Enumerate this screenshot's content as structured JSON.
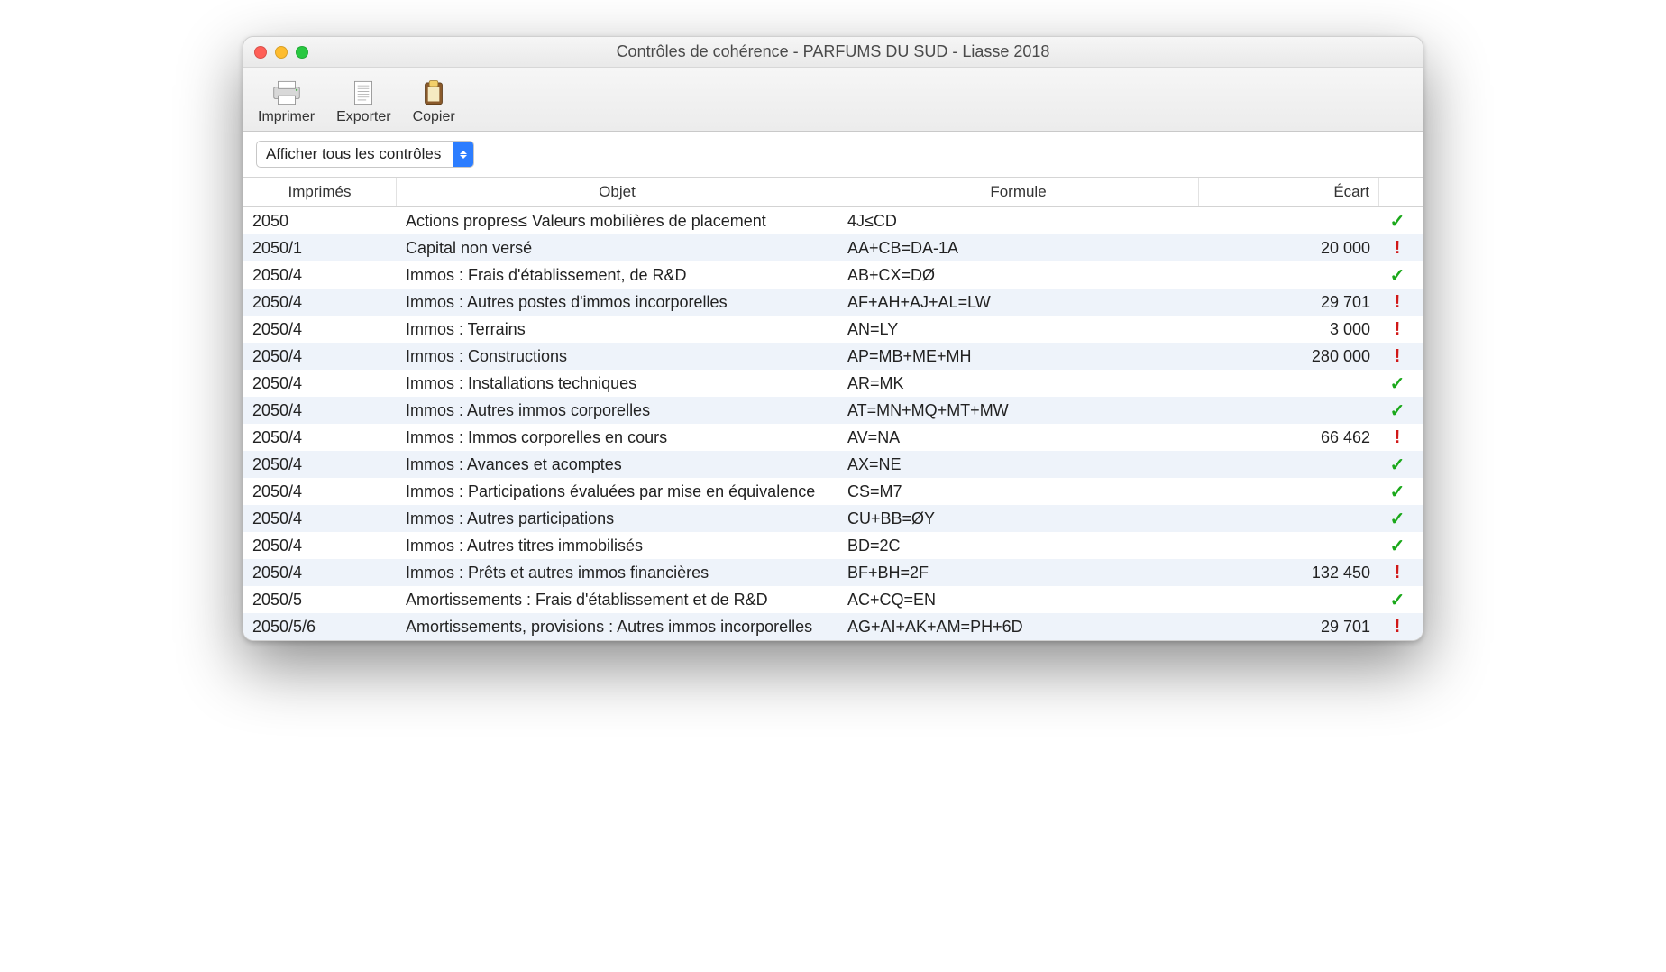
{
  "window": {
    "title": "Contrôles de cohérence - PARFUMS DU SUD - Liasse 2018"
  },
  "toolbar": {
    "print_label": "Imprimer",
    "export_label": "Exporter",
    "copy_label": "Copier"
  },
  "filter": {
    "selected": "Afficher tous les contrôles"
  },
  "columns": {
    "imprimes": "Imprimés",
    "objet": "Objet",
    "formule": "Formule",
    "ecart": "Écart"
  },
  "rows": [
    {
      "imprime": "2050",
      "objet": "Actions propres≤ Valeurs mobilières de placement",
      "formule": "4J≤CD",
      "ecart": "",
      "status": "ok"
    },
    {
      "imprime": "2050/1",
      "objet": "Capital non versé",
      "formule": "AA+CB=DA-1A",
      "ecart": "20 000",
      "status": "warn"
    },
    {
      "imprime": "2050/4",
      "objet": "Immos : Frais d'établissement, de R&D",
      "formule": "AB+CX=DØ",
      "ecart": "",
      "status": "ok"
    },
    {
      "imprime": "2050/4",
      "objet": "Immos : Autres postes d'immos incorporelles",
      "formule": "AF+AH+AJ+AL=LW",
      "ecart": "29 701",
      "status": "warn"
    },
    {
      "imprime": "2050/4",
      "objet": "Immos : Terrains",
      "formule": "AN=LY",
      "ecart": "3 000",
      "status": "warn"
    },
    {
      "imprime": "2050/4",
      "objet": "Immos : Constructions",
      "formule": "AP=MB+ME+MH",
      "ecart": "280 000",
      "status": "warn"
    },
    {
      "imprime": "2050/4",
      "objet": "Immos : Installations techniques",
      "formule": "AR=MK",
      "ecart": "",
      "status": "ok"
    },
    {
      "imprime": "2050/4",
      "objet": "Immos : Autres immos corporelles",
      "formule": "AT=MN+MQ+MT+MW",
      "ecart": "",
      "status": "ok"
    },
    {
      "imprime": "2050/4",
      "objet": "Immos : Immos corporelles en cours",
      "formule": "AV=NA",
      "ecart": "66 462",
      "status": "warn"
    },
    {
      "imprime": "2050/4",
      "objet": "Immos : Avances et acomptes",
      "formule": "AX=NE",
      "ecart": "",
      "status": "ok"
    },
    {
      "imprime": "2050/4",
      "objet": "Immos : Participations évaluées par mise en équivalence",
      "formule": "CS=M7",
      "ecart": "",
      "status": "ok"
    },
    {
      "imprime": "2050/4",
      "objet": "Immos : Autres participations",
      "formule": "CU+BB=ØY",
      "ecart": "",
      "status": "ok"
    },
    {
      "imprime": "2050/4",
      "objet": "Immos : Autres titres immobilisés",
      "formule": "BD=2C",
      "ecart": "",
      "status": "ok"
    },
    {
      "imprime": "2050/4",
      "objet": "Immos : Prêts et autres immos financières",
      "formule": "BF+BH=2F",
      "ecart": "132 450",
      "status": "warn"
    },
    {
      "imprime": "2050/5",
      "objet": "Amortissements : Frais d'établissement et de R&D",
      "formule": "AC+CQ=EN",
      "ecart": "",
      "status": "ok"
    },
    {
      "imprime": "2050/5/6",
      "objet": "Amortissements, provisions : Autres immos incorporelles",
      "formule": "AG+AI+AK+AM=PH+6D",
      "ecart": "29 701",
      "status": "warn"
    }
  ]
}
